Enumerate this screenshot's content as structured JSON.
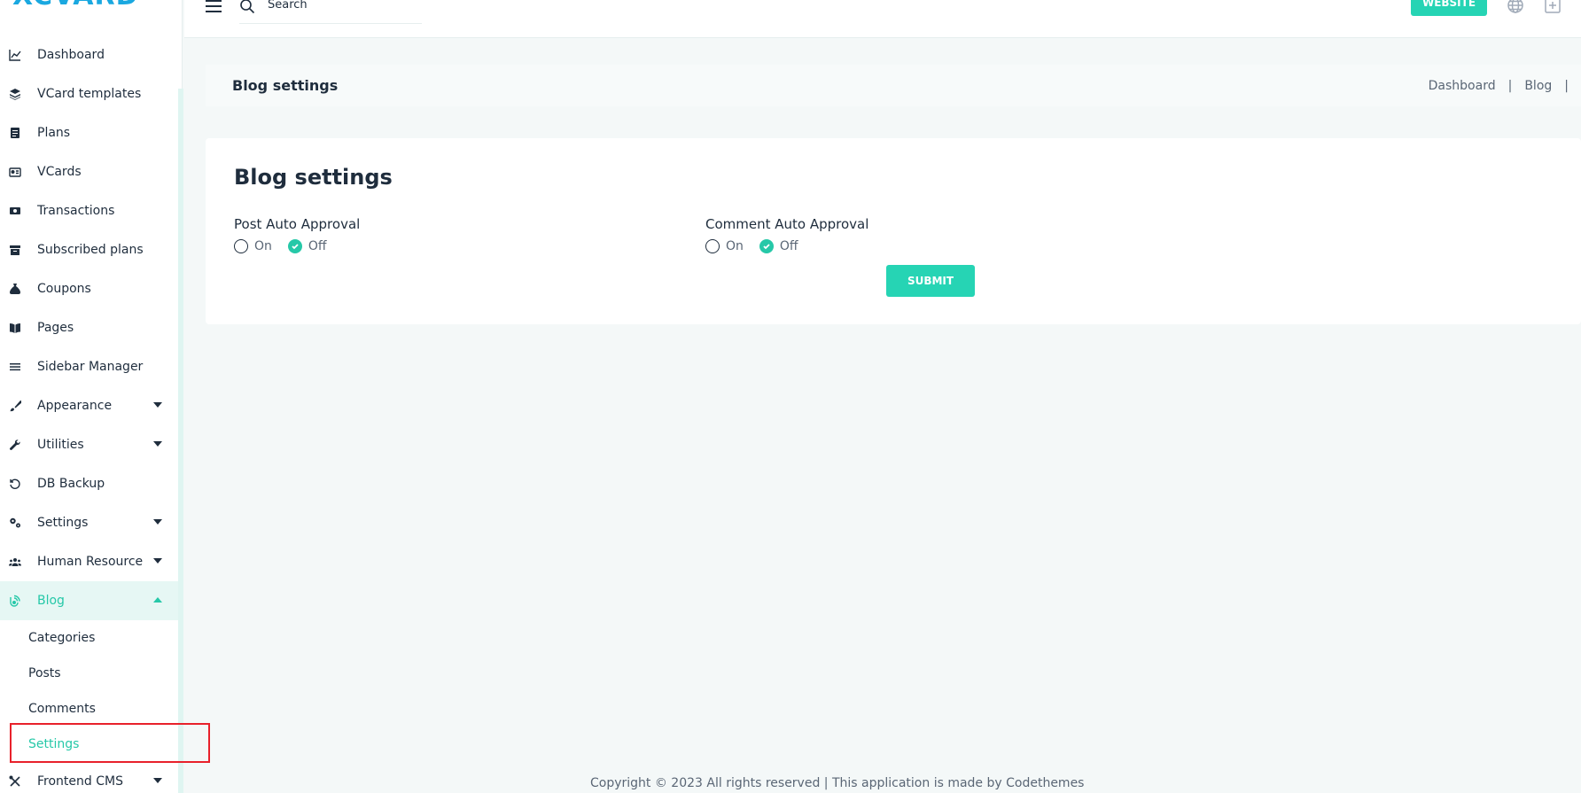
{
  "app": {
    "logo": "XCVARD"
  },
  "sidebar": {
    "items": [
      {
        "label": "Dashboard",
        "icon": "chart-line-icon"
      },
      {
        "label": "VCard templates",
        "icon": "layers-icon"
      },
      {
        "label": "Plans",
        "icon": "document-icon"
      },
      {
        "label": "VCards",
        "icon": "id-card-icon"
      },
      {
        "label": "Transactions",
        "icon": "money-bill-icon"
      },
      {
        "label": "Subscribed plans",
        "icon": "archive-icon"
      },
      {
        "label": "Coupons",
        "icon": "money-bag-icon"
      },
      {
        "label": "Pages",
        "icon": "book-open-icon"
      },
      {
        "label": "Sidebar Manager",
        "icon": "bars-icon"
      },
      {
        "label": "Appearance",
        "icon": "brush-icon"
      },
      {
        "label": "Utilities",
        "icon": "wrench-icon"
      },
      {
        "label": "DB Backup",
        "icon": "history-icon"
      },
      {
        "label": "Settings",
        "icon": "gears-icon"
      },
      {
        "label": "Human Resource",
        "icon": "users-icon"
      },
      {
        "label": "Blog",
        "icon": "blog-icon"
      }
    ],
    "blog_sub": [
      {
        "label": "Categories"
      },
      {
        "label": "Posts"
      },
      {
        "label": "Comments"
      },
      {
        "label": "Settings"
      }
    ],
    "after": {
      "label": "Frontend CMS",
      "icon": "tools-icon"
    }
  },
  "header": {
    "search_placeholder": "Search",
    "website_label": "WEBSITE"
  },
  "titlebar": {
    "title": "Blog settings",
    "breadcrumb": [
      "Dashboard",
      "|",
      "Blog",
      "|"
    ]
  },
  "card": {
    "title": "Blog settings",
    "post_auto_approval": {
      "label": "Post Auto Approval",
      "options": [
        "On",
        "Off"
      ],
      "selected": "Off"
    },
    "comment_auto_approval": {
      "label": "Comment Auto Approval",
      "options": [
        "On",
        "Off"
      ],
      "selected": "Off"
    },
    "submit_label": "SUBMIT"
  },
  "footer": {
    "text": "Copyright © 2023 All rights reserved | This application is made by Codethemes"
  },
  "colors": {
    "accent": "#26d4b4",
    "highlight": "#e8212b"
  }
}
